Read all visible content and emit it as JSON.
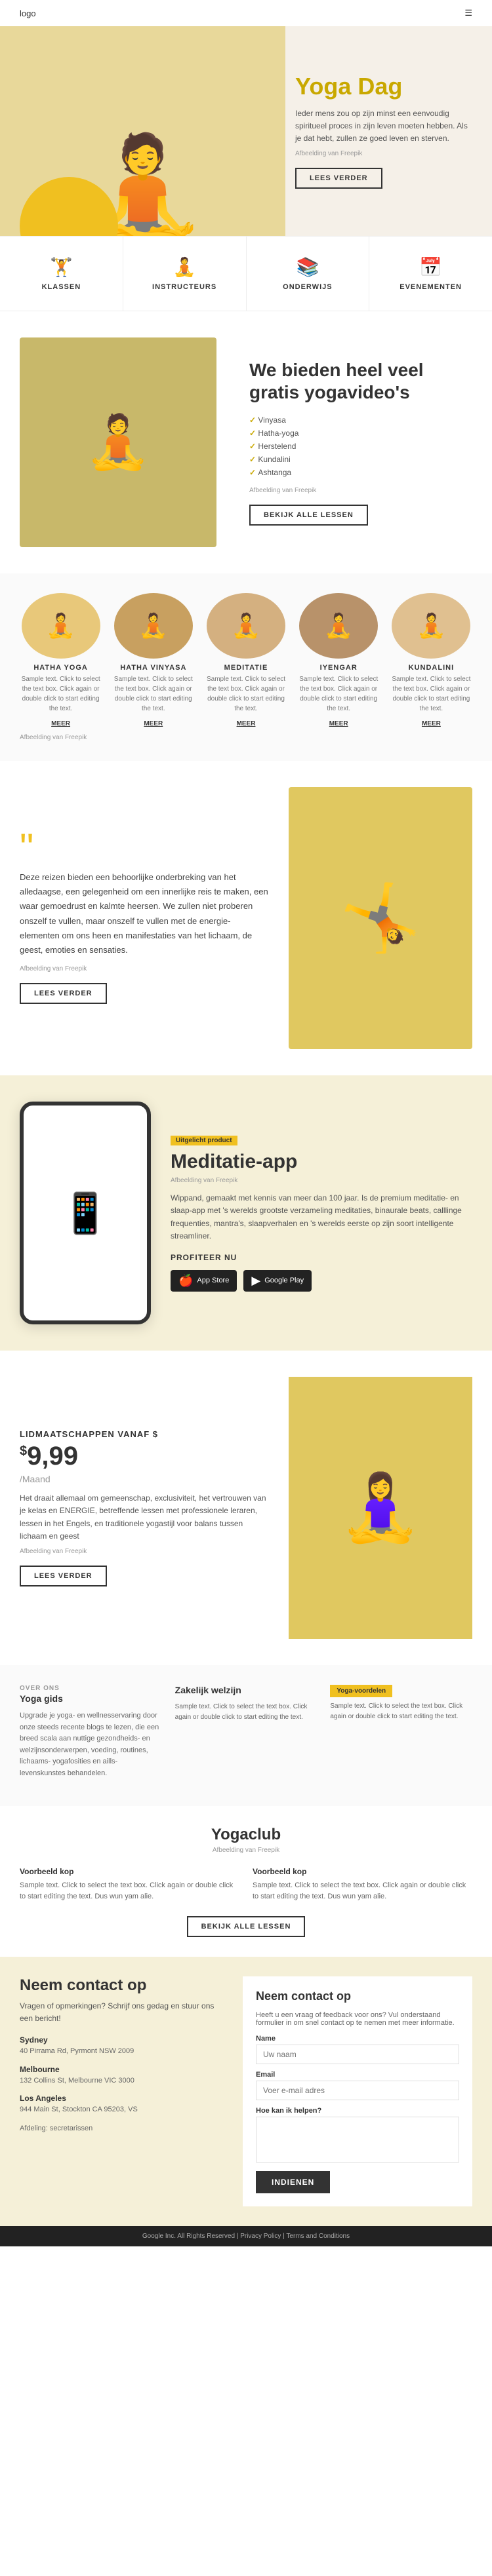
{
  "nav": {
    "logo": "logo",
    "menu_icon": "☰"
  },
  "hero": {
    "title_line1": "Yoga",
    "title_line2": "Dag",
    "text": "Ieder mens zou op zijn minst een eenvoudig spiritueel proces in zijn leven moeten hebben. Als je dat hebt, zullen ze goed leven en sterven.",
    "credit": "Afbeelding van Freepik",
    "cta": "LEES VERDER"
  },
  "features": [
    {
      "icon": "🏋",
      "label": "KLASSEN"
    },
    {
      "icon": "🧘",
      "label": "INSTRUCTEURS"
    },
    {
      "icon": "📚",
      "label": "ONDERWIJS"
    },
    {
      "icon": "📅",
      "label": "EVENEMENTEN"
    }
  ],
  "video_section": {
    "title": "We bieden heel veel gratis yogavideo's",
    "items": [
      "Vinyasa",
      "Hatha-yoga",
      "Herstelend",
      "Kundalini",
      "Ashtanga"
    ],
    "credit": "Afbeelding van Freepik",
    "cta": "BEKIJK ALLE LESSEN"
  },
  "yoga_types": [
    {
      "title": "HATHA YOGA",
      "text": "Sample text. Click to select the text box. Click again or double click to start editing the text.",
      "link": "MEER"
    },
    {
      "title": "HATHA VINYASA",
      "text": "Sample text. Click to select the text box. Click again or double click to start editing the text.",
      "link": "MEER"
    },
    {
      "title": "MEDITATIE",
      "text": "Sample text. Click to select the text box. Click again or double click to start editing the text.",
      "link": "MEER"
    },
    {
      "title": "IYENGAR",
      "text": "Sample text. Click to select the text box. Click again or double click to start editing the text.",
      "link": "MEER"
    },
    {
      "title": "KUNDALINI",
      "text": "Sample text. Click to select the text box. Click again or double click to start editing the text.",
      "link": "MEER"
    }
  ],
  "yoga_types_credit": "Afbeelding van Freepik",
  "quote": {
    "text": "Deze reizen bieden een behoorlijke onderbreking van het alledaagse, een gelegenheid om een innerlijke reis te maken, een waar gemoedrust en kalmte heersen. We zullen niet proberen onszelf te vullen, maar onszelf te vullen met de energie-elementen om ons heen en manifestaties van het lichaam, de geest, emoties en sensaties.",
    "credit": "Afbeelding van Freepik",
    "cta": "LEES VERDER"
  },
  "app": {
    "badge": "Uitgelicht product",
    "title": "Meditatie-app",
    "credit": "Afbeelding van Freepik",
    "text": "Wippand, gemaakt met kennis van meer dan 100 jaar. Is de premium meditatie- en slaap-app met 's werelds grootste verzameling meditaties, binaurale beats, calllinge frequenties, mantra's, slaapverhalen en 's werelds eerste op zijn soort intelligente streamliner.",
    "cta": "PROFITEER NU",
    "app_store": "App Store",
    "google_play": "Google Play"
  },
  "membership": {
    "label": "Lidmaatschappen vanaf $",
    "price": "9,99",
    "currency": "$",
    "period": "/Maand",
    "text": "Het draait allemaal om gemeenschap, exclusiviteit, het vertrouwen van je kelas en ENERGIE, betreffende lessen met professionele leraren, lessen in het Engels, en traditionele yogastijl voor balans tussen lichaam en geest",
    "credit": "Afbeelding van Freepik",
    "cta": "LEES VERDER"
  },
  "bottom": {
    "over_ons": {
      "title": "Yoga gids",
      "subtitle": "OVER ONS",
      "text": "Upgrade je yoga- en wellnesservaring door onze steeds recente blogs te lezen, die een breed scala aan nuttige gezondheids- en welzijnsonderwerpen, voeding, routines, lichaams- yogafosities en aills- levenskunstes behandelen."
    },
    "zakelijk": {
      "title": "Zakelijk welzijn",
      "text": "Sample text. Click to select the text box. Click again or double click to start editing the text."
    },
    "yoga_voordelen": {
      "badge": "Yoga-voordelen",
      "text": "Sample text. Click to select the text box. Click again or double click to start editing the text."
    }
  },
  "yoga_club": {
    "title": "Yogaclub",
    "credit": "Afbeelding van Freepik",
    "col1_title": "Voorbeeld kop",
    "col1_text": "Sample text. Click to select the text box. Click again or double click to start editing the text. Dus wun yam alie.",
    "col2_title": "Voorbeeld kop",
    "col2_text": "Sample text. Click to select the text box. Click again or double click to start editing the text. Dus wun yam alie.",
    "cta": "BEKIJK ALLE LESSEN"
  },
  "contact_left": {
    "title": "Neem contact op",
    "text": "Vragen of opmerkingen? Schrijf ons gedag en stuur ons een bericht!",
    "locations": [
      {
        "city": "Sydney",
        "address": "40 Pirrama Rd, Pyrmont NSW 2009"
      },
      {
        "city": "Melbourne",
        "address": "132 Collins St, Melbourne VIC 3000"
      },
      {
        "city": "Los Angeles",
        "address": "944 Main St, Stockton CA 95203, VS"
      }
    ],
    "extra_text": "Afdeling: secretarissen"
  },
  "contact_right": {
    "title": "Neem contact op",
    "text": "Heeft u een vraag of feedback voor ons? Vul onderstaand formulier in om snel contact op te nemen met meer informatie.",
    "fields": {
      "name_label": "Name",
      "name_placeholder": "Uw naam",
      "email_label": "Email",
      "email_placeholder": "Voer e-mail adres",
      "message_label": "Hoe kan ik helpen?",
      "message_placeholder": ""
    },
    "submit": "INDIENEN"
  },
  "footer": {
    "text": "Google Inc. All Rights Reserved | Privacy Policy | Terms and Conditions"
  }
}
